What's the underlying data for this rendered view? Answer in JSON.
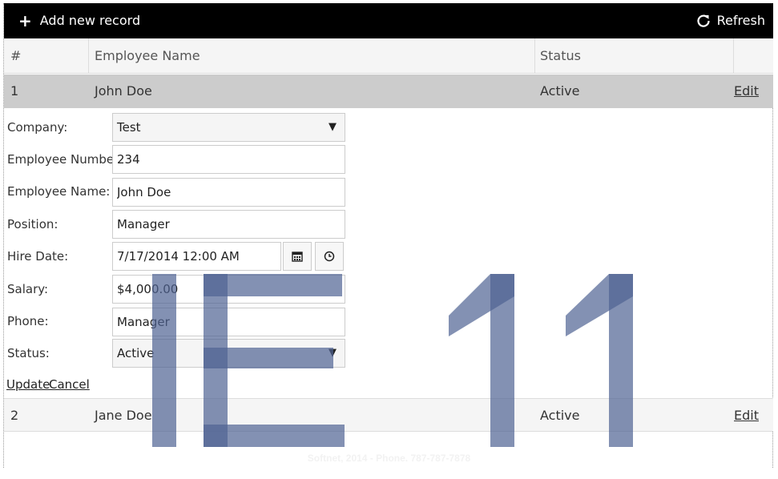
{
  "toolbar": {
    "add_label": "Add new record",
    "refresh_label": "Refresh"
  },
  "grid": {
    "headers": [
      "#",
      "Employee Name",
      "Status",
      ""
    ],
    "rows": [
      {
        "num": "1",
        "name": "John Doe",
        "status": "Active",
        "action": "Edit"
      },
      {
        "num": "2",
        "name": "Jane Doe",
        "status": "Active",
        "action": "Edit"
      }
    ]
  },
  "form": {
    "company": {
      "label": "Company:",
      "value": "Test"
    },
    "employee_number": {
      "label": "Employee Number:",
      "value": "234"
    },
    "employee_name": {
      "label": "Employee Name:",
      "value": "John Doe"
    },
    "position": {
      "label": "Position:",
      "value": "Manager"
    },
    "hire_date": {
      "label": "Hire Date:",
      "value": "7/17/2014 12:00 AM"
    },
    "salary": {
      "label": "Salary:",
      "value": "$4,000.00"
    },
    "phone": {
      "label": "Phone:",
      "value": "Manager"
    },
    "status": {
      "label": "Status:",
      "value": "Active"
    },
    "update_label": "Update",
    "cancel_label": "Cancel"
  },
  "watermark": {
    "text": "IE 11",
    "color": "#7b8cae"
  },
  "footer": {
    "text": "Softnet, 2014 - Phone. 787-787-7878"
  }
}
